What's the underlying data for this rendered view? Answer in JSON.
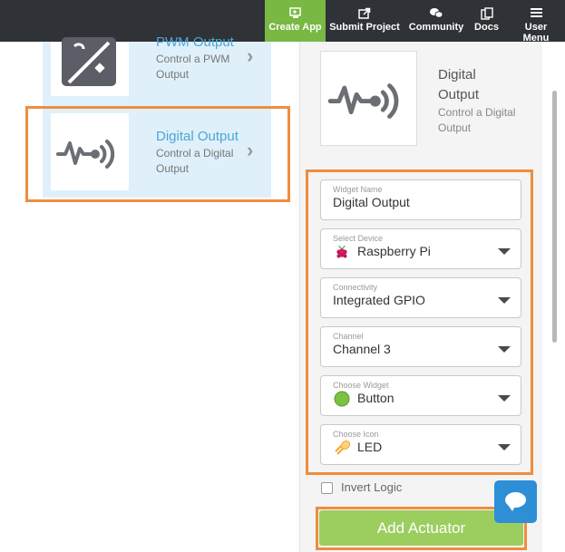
{
  "nav": {
    "items": [
      {
        "label": "Create App",
        "icon": "create-app-icon",
        "active": true
      },
      {
        "label": "Submit Project",
        "icon": "upload-icon"
      },
      {
        "label": "Community",
        "icon": "chat-bubbles-icon"
      },
      {
        "label": "Docs",
        "icon": "docs-icon"
      },
      {
        "label": "User Menu",
        "icon": "hamburger-icon"
      }
    ]
  },
  "catalog": {
    "items": [
      {
        "title": "PWM Output",
        "description": "Control a PWM Output",
        "icon": "pwm-output-icon"
      },
      {
        "title": "Digital Output",
        "description": "Control a Digital Output",
        "icon": "digital-output-icon",
        "selected": true
      }
    ]
  },
  "preview": {
    "title": "Digital Output",
    "description": "Control a Digital Output",
    "icon": "digital-output-icon"
  },
  "form": {
    "widget_name": {
      "label": "Widget Name",
      "value": "Digital Output"
    },
    "device": {
      "label": "Select Device",
      "value": "Raspberry Pi",
      "icon": "raspberry-pi-icon"
    },
    "connectivity": {
      "label": "Connectivity",
      "value": "Integrated GPIO"
    },
    "channel": {
      "label": "Channel",
      "value": "Channel 3"
    },
    "widget": {
      "label": "Choose Widget",
      "value": "Button",
      "icon": "green-circle-icon"
    },
    "icon_choice": {
      "label": "Choose Icon",
      "value": "LED",
      "icon": "led-icon"
    },
    "invert_logic": {
      "label": "Invert Logic",
      "checked": false
    },
    "submit_label": "Add Actuator"
  },
  "colors": {
    "nav_bg": "#2f3236",
    "nav_active": "#78b843",
    "highlight": "#ef8d3e",
    "link_blue": "#4aa6d7",
    "button_green": "#9bce5f",
    "chat_blue": "#2e8ed6"
  }
}
